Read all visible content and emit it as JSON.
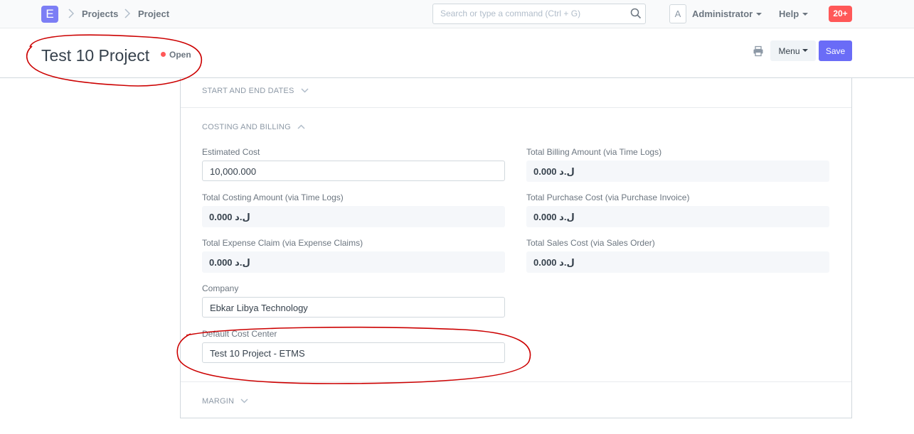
{
  "navbar": {
    "logo_letter": "E",
    "breadcrumbs": [
      "Projects",
      "Project"
    ],
    "search_placeholder": "Search or type a command (Ctrl + G)",
    "avatar_letter": "A",
    "user_label": "Administrator",
    "help_label": "Help",
    "notifications_count": "20+"
  },
  "page": {
    "title": "Test 10 Project",
    "status": "Open",
    "menu_label": "Menu",
    "save_label": "Save",
    "status_color": "#ff5858",
    "accent_color": "#6a6cf7"
  },
  "sections": {
    "dates": "START AND END DATES",
    "costing": "COSTING AND BILLING",
    "margin": "MARGIN"
  },
  "fields": {
    "estimated_cost": {
      "label": "Estimated Cost",
      "value": "10,000.000"
    },
    "total_billing_amount": {
      "label": "Total Billing Amount (via Time Logs)",
      "value": "ل.د 0.000"
    },
    "total_costing_amount": {
      "label": "Total Costing Amount (via Time Logs)",
      "value": "ل.د 0.000"
    },
    "total_purchase_cost": {
      "label": "Total Purchase Cost (via Purchase Invoice)",
      "value": "ل.د 0.000"
    },
    "total_expense_claim": {
      "label": "Total Expense Claim (via Expense Claims)",
      "value": "ل.د 0.000"
    },
    "total_sales_cost": {
      "label": "Total Sales Cost (via Sales Order)",
      "value": "ل.د 0.000"
    },
    "company": {
      "label": "Company",
      "value": "Ebkar Libya Technology"
    },
    "default_cost_center": {
      "label": "Default Cost Center",
      "value": "Test 10 Project - ETMS"
    }
  },
  "annotations": {
    "color": "#cc0000"
  }
}
